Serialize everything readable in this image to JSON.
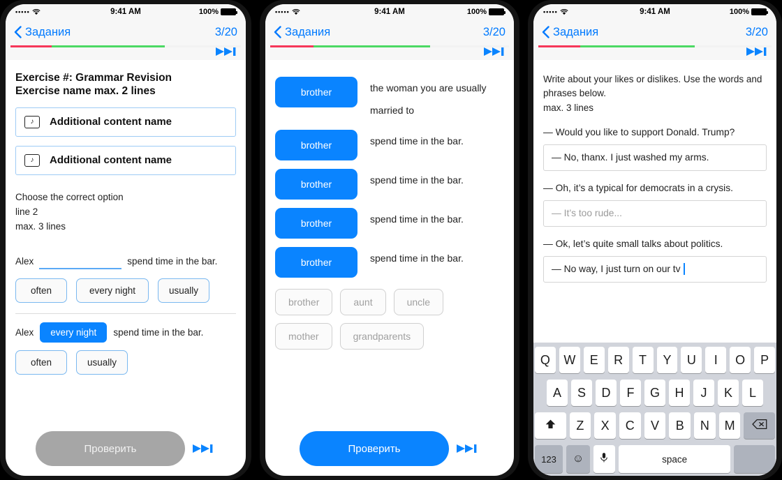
{
  "status_bar": {
    "signal": "•••••",
    "time": "9:41 AM",
    "battery": "100%"
  },
  "nav": {
    "back_label": "Задания",
    "counter": "3/20"
  },
  "progress": {
    "red_pct": 18,
    "green_pct": 49,
    "red_color": "#f6375a",
    "green_color": "#4cd964",
    "track_color": "#f2f2f2"
  },
  "colors": {
    "accent_blue": "#0a84ff",
    "link_blue": "#007aff",
    "grey_button": "#a6a6a6",
    "chip_border": "#7ab8f0",
    "pool_text": "#a0a0a0"
  },
  "panel1": {
    "exercise_title": "Exercise #: Grammar Revision\nExercise name max. 2 lines",
    "content_cards": [
      {
        "icon": "music-note-icon",
        "label": "Additional content name"
      },
      {
        "icon": "music-note-icon",
        "label": "Additional content name"
      }
    ],
    "instructions": "Choose the correct option\nline 2\nmax. 3 lines",
    "task1": {
      "subject": "Alex",
      "blank": "",
      "tail": "spend time in the bar.",
      "options": [
        "often",
        "every night",
        "usually"
      ]
    },
    "task2": {
      "subject": "Alex",
      "selected": "every night",
      "tail": "spend time in the bar.",
      "options": [
        "often",
        "usually"
      ]
    },
    "check_label": "Проверить"
  },
  "panel2": {
    "rows": [
      {
        "chip": "brother",
        "text": "the woman you are usually married to"
      },
      {
        "chip": "brother",
        "text": "spend time in the bar."
      },
      {
        "chip": "brother",
        "text": "spend time in the bar."
      },
      {
        "chip": "brother",
        "text": "spend time in the bar."
      },
      {
        "chip": "brother",
        "text": "spend time in the bar."
      }
    ],
    "pool": [
      "brother",
      "aunt",
      "uncle",
      "mother",
      "grandparents"
    ],
    "check_label": "Проверить"
  },
  "panel3": {
    "prompt": "Write about your likes or dislikes. Use the words and phrases below.\nmax. 3 lines",
    "dialog": [
      {
        "type": "line",
        "text": "— Would you like to support Donald. Trump?"
      },
      {
        "type": "input",
        "value": "— No, thanx. I just washed my arms.",
        "placeholder": ""
      },
      {
        "type": "line",
        "text": "— Oh, it’s a typical for democrats in a crysis."
      },
      {
        "type": "input",
        "value": "",
        "placeholder": "— It’s too rude..."
      },
      {
        "type": "line",
        "text": "— Ok, let’s quite small talks about politics."
      },
      {
        "type": "input",
        "value": "— No way, I just turn on our tv",
        "placeholder": "",
        "caret": true
      }
    ],
    "keyboard": {
      "row1": [
        "Q",
        "W",
        "E",
        "R",
        "T",
        "Y",
        "U",
        "I",
        "O",
        "P"
      ],
      "row2": [
        "A",
        "S",
        "D",
        "F",
        "G",
        "H",
        "J",
        "K",
        "L"
      ],
      "row3_shift": "shift-icon",
      "row3": [
        "Z",
        "X",
        "C",
        "V",
        "B",
        "N",
        "M"
      ],
      "row3_backspace": "backspace-icon",
      "row4_numbers": "123",
      "row4_emoji": "emoji-icon",
      "row4_mic": "microphone-icon",
      "row4_space": "space",
      "row4_blank": ""
    }
  }
}
